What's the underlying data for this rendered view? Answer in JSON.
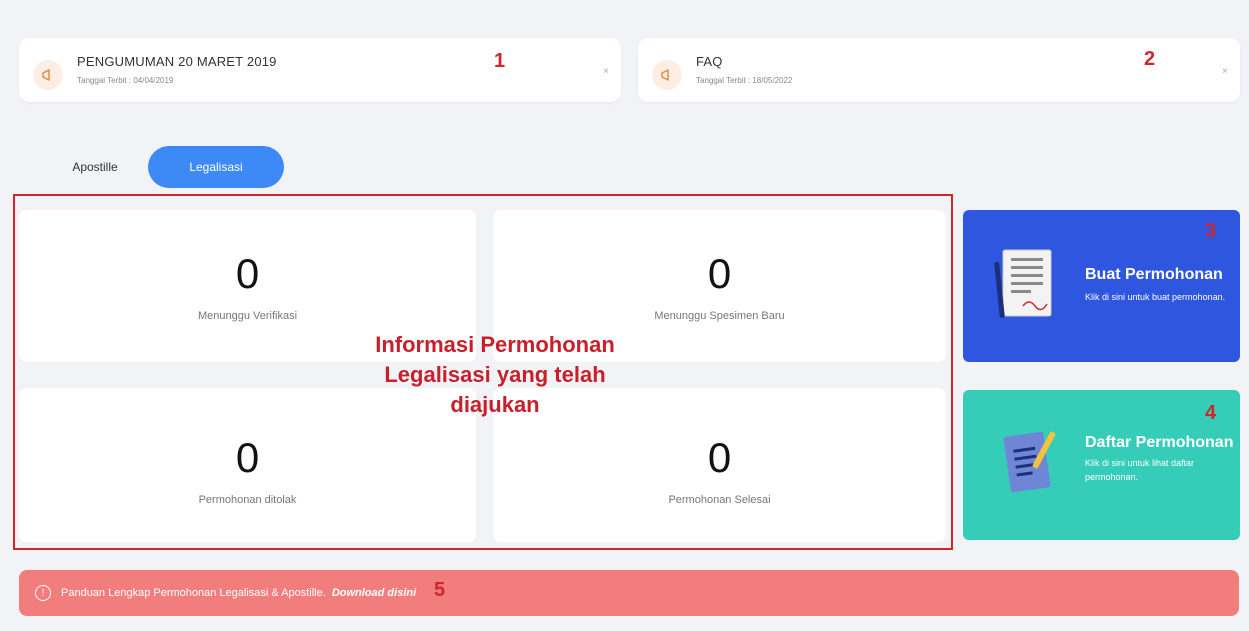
{
  "announcements": [
    {
      "title": "PENGUMUMAN 20 MARET 2019",
      "date": "Tanggal Terbit : 04/04/2019",
      "close": "×",
      "marker": "1"
    },
    {
      "title": "FAQ",
      "date": "Tanggal Terbit : 18/05/2022",
      "close": "×",
      "marker": "2"
    }
  ],
  "tabs": {
    "apostille": "Apostille",
    "legalisasi": "Legalisasi"
  },
  "stats": [
    {
      "value": "0",
      "label": "Menunggu Verifikasi"
    },
    {
      "value": "0",
      "label": "Menunggu Spesimen Baru"
    },
    {
      "value": "0",
      "label": "Permohonan ditolak"
    },
    {
      "value": "0",
      "label": "Permohonan Selesai"
    }
  ],
  "overlay": {
    "line1": "Informasi Permohonan",
    "line2": "Legalisasi yang telah",
    "line3": "diajukan"
  },
  "actions": [
    {
      "title": "Buat Permohonan",
      "desc": "Klik di sini untuk buat permohonan.",
      "marker": "3",
      "color": "#2f56de"
    },
    {
      "title": "Daftar Permohonan",
      "desc": "Klik di sini untuk lihat daftar permohonan.",
      "marker": "4",
      "color": "#35cdb7"
    }
  ],
  "guide": {
    "text": "Panduan Lengkap Permohonan Legalisasi & Apostille.",
    "link": "Download disini",
    "marker": "5"
  },
  "colors": {
    "accent": "#3d8af7",
    "annotation_red": "#d0262b",
    "bar": "#f27d7d"
  }
}
